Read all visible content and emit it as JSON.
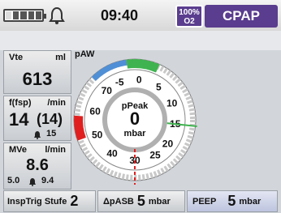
{
  "header": {
    "time": "09:40",
    "o2_value": "100%",
    "o2_unit": "O2",
    "mode": "CPAP",
    "battery_icon": "battery-icon",
    "alarm_icon": "bell-icon"
  },
  "left": {
    "vte": {
      "label": "Vte",
      "unit": "ml",
      "value": "613"
    },
    "freq": {
      "label": "f(fsp)",
      "unit": "/min",
      "value": "14",
      "value2": "(14)",
      "alarm": "15"
    },
    "mve": {
      "label": "MVe",
      "unit": "l/min",
      "value": "8.6",
      "low": "5.0",
      "high": "9.4"
    }
  },
  "gauge": {
    "title": "pAW",
    "center_label": "pPeak",
    "center_value": "0",
    "center_unit": "mbar",
    "side_unit": "mbar",
    "scale": [
      "-5",
      "0",
      "5",
      "10",
      "15",
      "20",
      "25",
      "30",
      "40",
      "50",
      "60",
      "70"
    ],
    "current_value": 0,
    "peep_marker": 5,
    "peep_limit": 15,
    "alarm_limit": 30,
    "colors": {
      "green": "#3fb34f",
      "red": "#e02020",
      "blue": "#4f8fd6"
    }
  },
  "footer": {
    "insptrig": {
      "label": "InspTrig Stufe",
      "value": "2"
    },
    "dpasb": {
      "label": "ΔpASB",
      "value": "5",
      "unit": "mbar"
    },
    "peep": {
      "label": "PEEP",
      "value": "5",
      "unit": "mbar"
    }
  }
}
